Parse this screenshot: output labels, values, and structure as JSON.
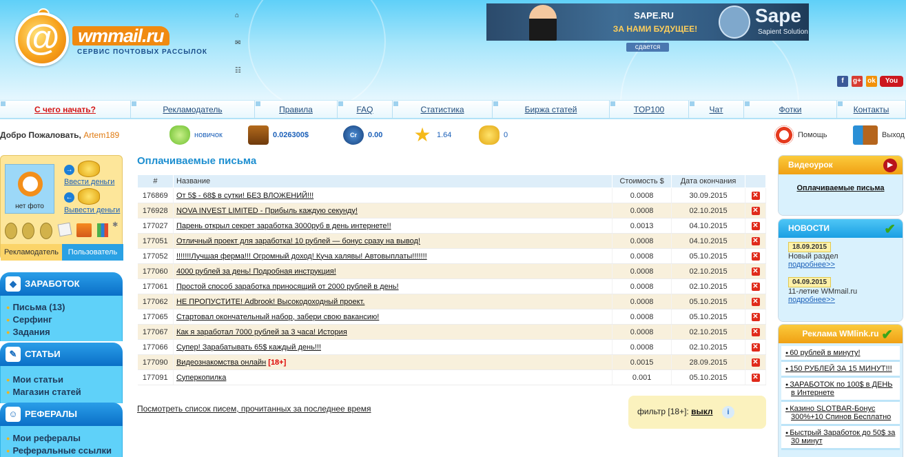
{
  "header": {
    "logo_text": "wmmail.ru",
    "logo_subtitle": "СЕРВИС ПОЧТОВЫХ РАССЫЛОК",
    "banner": {
      "line1": "SAPE.RU",
      "line2": "ЗА НАМИ БУДУЩЕЕ!",
      "brand": "Sape",
      "brand_sub": "Sapient Solution",
      "rent_label": "сдается"
    },
    "top_icons": [
      "home-icon",
      "mail-icon",
      "sitemap-icon"
    ],
    "social": [
      {
        "name": "facebook-icon",
        "glyph": "f",
        "color": "#3b5998"
      },
      {
        "name": "google-plus-icon",
        "glyph": "g+",
        "color": "#d73d32"
      },
      {
        "name": "odnoklassniki-icon",
        "glyph": "ok",
        "color": "#f2910a"
      },
      {
        "name": "youtube-icon",
        "glyph": "You",
        "color": "#cc181e"
      }
    ]
  },
  "nav": {
    "items": [
      "С чего начать?",
      "Рекламодатель",
      "Правила",
      "FAQ",
      "Статистика",
      "Биржа статей",
      "TOP100",
      "Чат",
      "Фотки",
      "Контакты"
    ]
  },
  "userbar": {
    "welcome": "Добро Пожаловать,",
    "username": "Artem189",
    "status": "новичок",
    "balance": "0.026300$",
    "credits": "0.00",
    "rating": "1.64",
    "coins": "0",
    "help": "Помощь",
    "logout": "Выход"
  },
  "profile": {
    "no_photo": "нет фото",
    "deposit": "Ввести деньги",
    "withdraw": "Вывести деньги",
    "tab_advertiser": "Рекламодатель",
    "tab_user": "Пользователь"
  },
  "menu": {
    "earn": {
      "title": "ЗАРАБОТОК",
      "items": [
        "Письма (13)",
        "Серфинг",
        "Задания"
      ]
    },
    "articles": {
      "title": "СТАТЬИ",
      "items": [
        "Мои статьи",
        "Магазин статей"
      ]
    },
    "referrals": {
      "title": "РЕФЕРАЛЫ",
      "items": [
        "Мои рефералы",
        "Реферальные ссылки"
      ]
    }
  },
  "main": {
    "title": "Оплачиваемые письма",
    "columns": [
      "#",
      "Название",
      "Стоимость $",
      "Дата окончания"
    ],
    "rows": [
      {
        "id": "176869",
        "title": "От 5$ - 68$ в сутки! БЕЗ ВЛОЖЕНИЙ!!!",
        "tag": "",
        "cost": "0.0008",
        "date": "30.09.2015"
      },
      {
        "id": "176928",
        "title": "NOVA INVEST LIMITED - Прибыль каждую секунду!",
        "tag": "",
        "cost": "0.0008",
        "date": "02.10.2015"
      },
      {
        "id": "177027",
        "title": "Парень открыл секрет заработка 3000руб в день интернете!!",
        "tag": "",
        "cost": "0.0013",
        "date": "04.10.2015"
      },
      {
        "id": "177051",
        "title": "Отличный проект для заработка! 10 рублей — бонус сразу на вывод!",
        "tag": "",
        "cost": "0.0008",
        "date": "04.10.2015"
      },
      {
        "id": "177052",
        "title": "!!!!!!!Лучшая ферма!!! Огромный доход! Куча халявы! Автовыплаты!!!!!!!",
        "tag": "",
        "cost": "0.0008",
        "date": "05.10.2015"
      },
      {
        "id": "177060",
        "title": "4000 рублей за день! Подробная инструкция!",
        "tag": "",
        "cost": "0.0008",
        "date": "02.10.2015"
      },
      {
        "id": "177061",
        "title": "Простой способ заработка приносящий от 2000 рублей в день!",
        "tag": "",
        "cost": "0.0008",
        "date": "02.10.2015"
      },
      {
        "id": "177062",
        "title": "НЕ ПРОПУСТИТЕ! Adbrook! Высокодоходный проект.",
        "tag": "",
        "cost": "0.0008",
        "date": "05.10.2015"
      },
      {
        "id": "177065",
        "title": "Стартовал окончательный набор, забери свою вакансию!",
        "tag": "",
        "cost": "0.0008",
        "date": "05.10.2015"
      },
      {
        "id": "177067",
        "title": "Как я заработал 7000 рублей за 3 часа! История",
        "tag": "",
        "cost": "0.0008",
        "date": "02.10.2015"
      },
      {
        "id": "177066",
        "title": "Супер! Зарабатывать 65$ каждый день!!!",
        "tag": "",
        "cost": "0.0008",
        "date": "02.10.2015"
      },
      {
        "id": "177090",
        "title": "Видеознакомства онлайн",
        "tag": "[18+]",
        "cost": "0.0015",
        "date": "28.09.2015"
      },
      {
        "id": "177091",
        "title": "Суперкопилка",
        "tag": "",
        "cost": "0.001",
        "date": "05.10.2015"
      }
    ],
    "read_list_link": "Посмотреть список писем, прочитанных за последнее время",
    "filter_label": "фильтр [18+]:",
    "filter_value": "выкл"
  },
  "right": {
    "video": {
      "title": "Видеоурок",
      "link": "Оплачиваемые письма"
    },
    "news": {
      "title": "НОВОСТИ",
      "items": [
        {
          "date": "18.09.2015",
          "text": "Новый раздел",
          "more": "подробнее>>"
        },
        {
          "date": "04.09.2015",
          "text": "11-летие WMmail.ru",
          "more": "подробнее>>"
        }
      ]
    },
    "ads": {
      "title": "Реклама WMlink.ru",
      "items": [
        "60 рублей в минуту!",
        "150 РУБЛЕЙ ЗА 15 МИНУТ!!!",
        "ЗАРАБОТОК по 100$ в ДЕНЬ в Интернете",
        "Казино SLOTBAR-Бонус 300%+10 Спинов Бесплатно",
        "Быстрый Заработок до 50$ за 30 минут"
      ]
    }
  },
  "colors": {
    "accent_blue": "#1c8ed0",
    "logo_orange": "#f08a10",
    "row_alt": "#f8f0dc",
    "nav_red": "#d41414"
  }
}
